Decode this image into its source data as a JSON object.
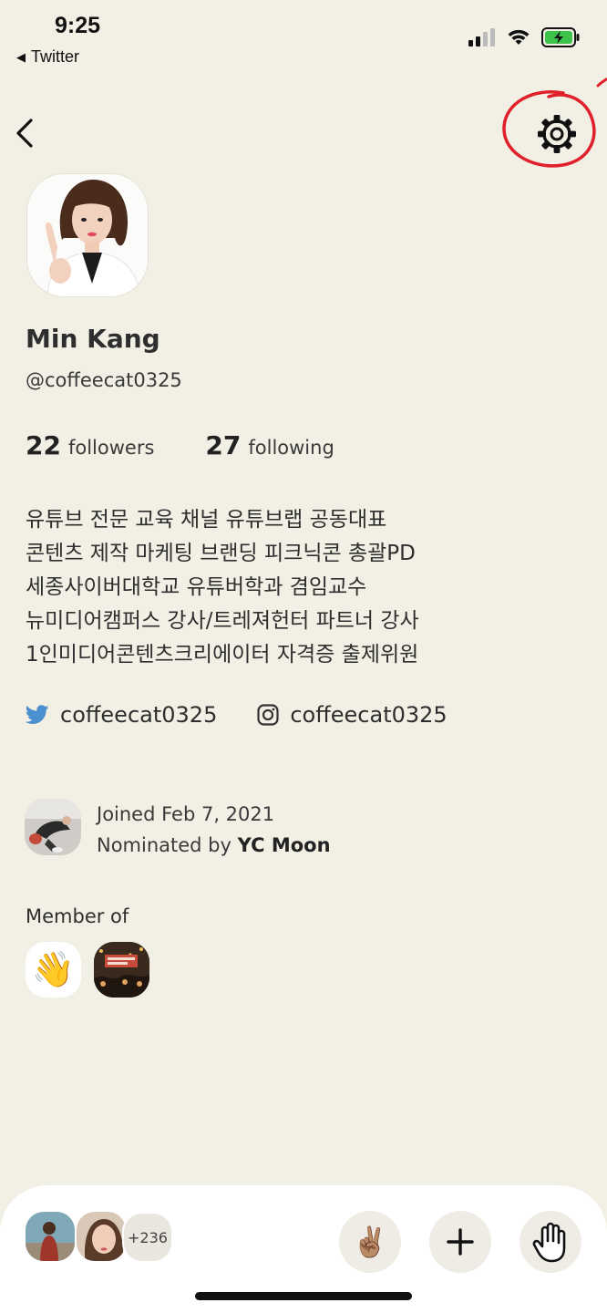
{
  "status_bar": {
    "time": "9:25",
    "back_app": "Twitter",
    "back_arrow": "◀"
  },
  "profile": {
    "name": "Min Kang",
    "handle": "@coffeecat0325",
    "followers_count": "22",
    "followers_label": "followers",
    "following_count": "27",
    "following_label": "following",
    "bio": [
      "유튜브 전문 교육 채널 유튜브랩 공동대표",
      "콘텐츠 제작 마케팅 브랜딩 피크닉콘 총괄PD",
      "세종사이버대학교 유튜버학과 겸임교수",
      "뉴미디어캠퍼스 강사/트레져헌터 파트너 강사",
      "1인미디어콘텐츠크리에이터 자격증 출제위원"
    ],
    "twitter": "coffeecat0325",
    "instagram": "coffeecat0325",
    "joined": "Joined Feb 7, 2021",
    "nominated_prefix": "Nominated by",
    "nominated_by": "YC Moon",
    "member_of_label": "Member of",
    "club_1_emoji": "👋"
  },
  "bottom_bar": {
    "more_count": "+236",
    "peace_emoji": "✌🏽"
  },
  "colors": {
    "background": "#f2f0e4",
    "annotation": "#e0202a",
    "twitter_blue": "#4a8fd0"
  },
  "icons": [
    "back-chevron-icon",
    "gear-icon",
    "twitter-icon",
    "instagram-icon",
    "plus-icon",
    "raise-hand-icon",
    "signal-icon",
    "wifi-icon",
    "battery-icon"
  ]
}
